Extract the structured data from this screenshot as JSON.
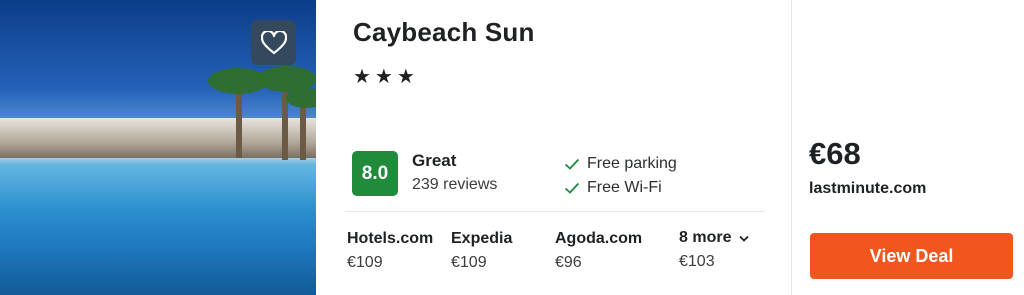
{
  "hotel": {
    "name": "Caybeach Sun",
    "stars": "★★★",
    "photo_icon": "hotel-pool-photo",
    "favorite_icon": "heart-icon"
  },
  "rating": {
    "score": "8.0",
    "label": "Great",
    "reviews": "239 reviews",
    "color": "#1f8b3b"
  },
  "amenities": [
    {
      "label": "Free parking",
      "icon": "check-icon"
    },
    {
      "label": "Free Wi-Fi",
      "icon": "check-icon"
    }
  ],
  "offers": [
    {
      "site": "Hotels.com",
      "price": "€109"
    },
    {
      "site": "Expedia",
      "price": "€109"
    },
    {
      "site": "Agoda.com",
      "price": "€96"
    },
    {
      "site": "8 more",
      "price": "€103",
      "icon": "chevron-down-icon"
    }
  ],
  "best_deal": {
    "price": "€68",
    "provider": "lastminute.com",
    "button_label": "View Deal",
    "button_color": "#f0561d"
  }
}
